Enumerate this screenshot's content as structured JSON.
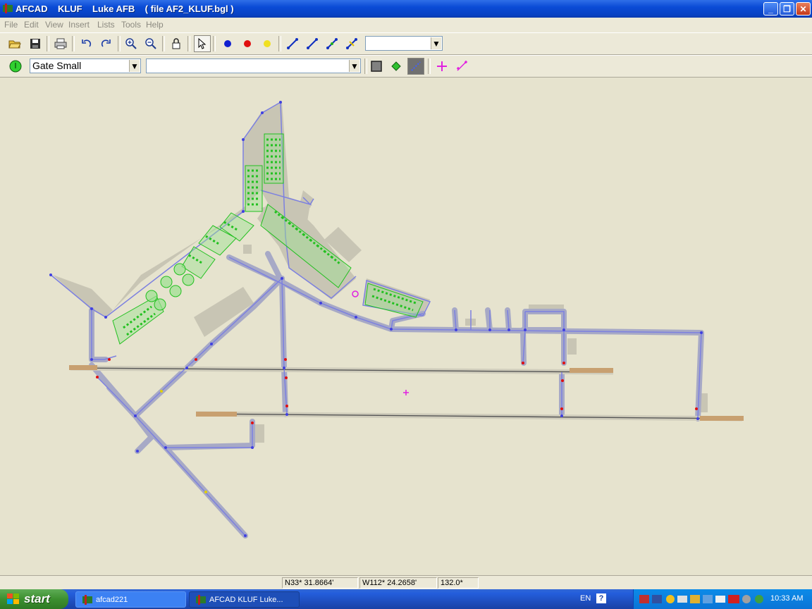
{
  "window": {
    "title": "AFCAD    KLUF    Luke AFB    ( file AF2_KLUF.bgl )"
  },
  "menu": [
    "File",
    "Edit",
    "View",
    "Insert",
    "Lists",
    "Tools",
    "Help"
  ],
  "toolbar1": {
    "buttons": [
      "open-icon",
      "save-icon",
      "print-icon",
      "undo-icon",
      "redo-icon",
      "zoom-in-icon",
      "zoom-out-icon",
      "lock-icon",
      "select-arrow-icon",
      "blue-node-icon",
      "red-node-icon",
      "yellow-node-icon",
      "path-tool-1-icon",
      "path-tool-2-icon",
      "path-tool-3-icon",
      "path-tool-4-icon"
    ],
    "combo_value": ""
  },
  "toolbar2": {
    "parking_type": "Gate Small",
    "second_combo_value": ""
  },
  "status": {
    "lat": "N33* 31.8664'",
    "lon": "W112* 24.2658'",
    "heading": "132.0*"
  },
  "taskbar": {
    "start_label": "start",
    "tasks": [
      {
        "label": "afcad221",
        "active": false
      },
      {
        "label": "AFCAD    KLUF    Luke...",
        "active": true
      }
    ],
    "language": "EN",
    "clock": "10:33 AM"
  },
  "colors": {
    "taxiway": "#7C80E0",
    "parking": "#22C020",
    "apron": "#C8C5B4",
    "background": "#E6E3CE"
  }
}
